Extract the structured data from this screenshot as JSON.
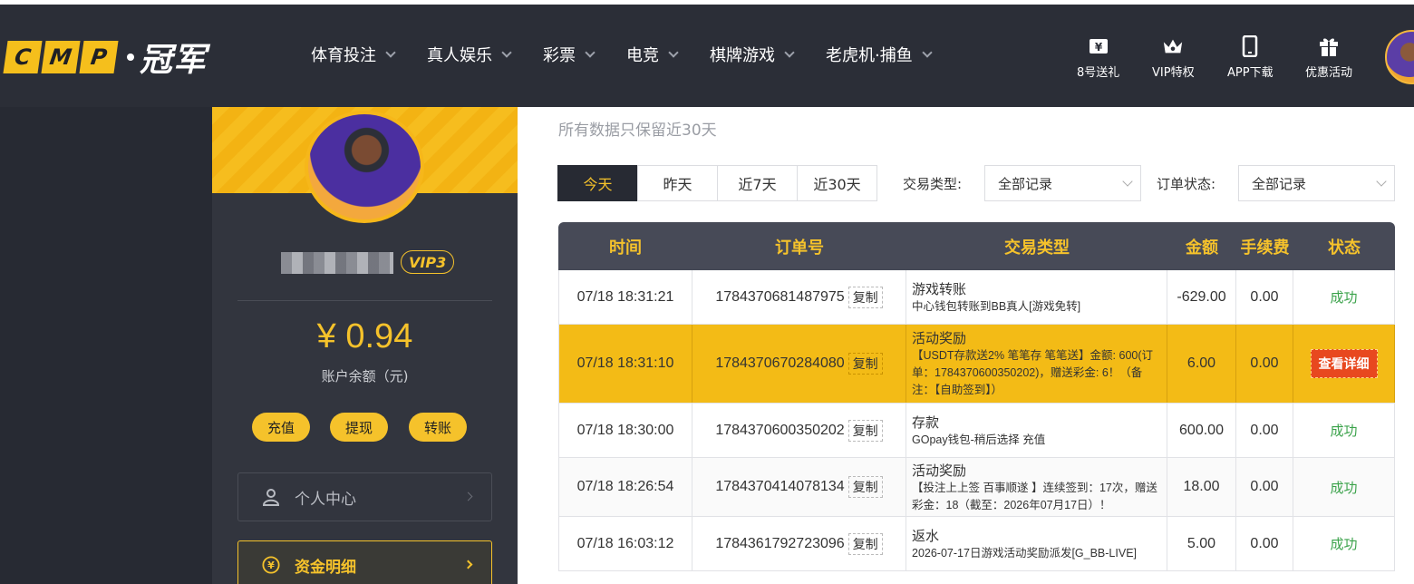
{
  "header": {
    "logo_letters": [
      "C",
      "M",
      "P"
    ],
    "logo_cn": "冠军",
    "nav": [
      {
        "label": "体育投注"
      },
      {
        "label": "真人娱乐"
      },
      {
        "label": "彩票"
      },
      {
        "label": "电竞"
      },
      {
        "label": "棋牌游戏"
      },
      {
        "label": "老虎机·捕鱼"
      }
    ],
    "quick_links": [
      {
        "label": "8号送礼",
        "icon": "gift-ticket-icon"
      },
      {
        "label": "VIP特权",
        "icon": "crown-icon"
      },
      {
        "label": "APP下载",
        "icon": "phone-icon"
      },
      {
        "label": "优惠活动",
        "icon": "gift-box-icon"
      }
    ]
  },
  "sidebar": {
    "vip_label": "VIP3",
    "balance": "¥ 0.94",
    "balance_label": "账户余额（元)",
    "buttons": {
      "deposit": "充值",
      "withdraw": "提现",
      "transfer": "转账"
    },
    "menu": [
      {
        "label": "个人中心",
        "icon": "user-icon",
        "active": false
      },
      {
        "label": "资金明细",
        "icon": "yuan-coin-icon",
        "active": true
      }
    ]
  },
  "main": {
    "notice": "所有数据只保留近30天",
    "tabs": [
      "今天",
      "昨天",
      "近7天",
      "近30天"
    ],
    "active_tab": "今天",
    "filters": {
      "type_label": "交易类型:",
      "type_value": "全部记录",
      "status_label": "订单状态:",
      "status_value": "全部记录"
    },
    "table": {
      "headers": [
        "时间",
        "订单号",
        "交易类型",
        "金额",
        "手续费",
        "状态"
      ],
      "copy_label": "复制",
      "rows": [
        {
          "time": "07/18 18:31:21",
          "order": "1784370681487975",
          "type_title": "游戏转账",
          "type_desc": "中心钱包转账到BB真人[游戏免转]",
          "amount": "-629.00",
          "fee": "0.00",
          "status": "成功",
          "highlight": false
        },
        {
          "time": "07/18 18:31:10",
          "order": "1784370670284080",
          "type_title": "活动奖励",
          "type_desc": "【USDT存款送2% 笔笔存 笔笔送】金额: 600(订单：1784370600350202)，赠送彩金: 6！（备注：【自助签到】）",
          "amount": "6.00",
          "fee": "0.00",
          "status": "查看详细",
          "highlight": true
        },
        {
          "time": "07/18 18:30:00",
          "order": "1784370600350202",
          "type_title": "存款",
          "type_desc": "GOpay钱包-稍后选择 充值",
          "amount": "600.00",
          "fee": "0.00",
          "status": "成功",
          "highlight": false
        },
        {
          "time": "07/18 18:26:54",
          "order": "1784370414078134",
          "type_title": "活动奖励",
          "type_desc": "【投注上上签 百事顺遂 】连续签到：17次，赠送彩金：18（截至：2026年07月17日）！",
          "amount": "18.00",
          "fee": "0.00",
          "status": "成功",
          "highlight": false
        },
        {
          "time": "07/18 16:03:12",
          "order": "1784361792723096",
          "type_title": "返水",
          "type_desc": "2026-07-17日游戏活动奖励派发[G_BB-LIVE]",
          "amount": "5.00",
          "fee": "0.00",
          "status": "成功",
          "highlight": false
        }
      ]
    }
  },
  "colors": {
    "accent": "#f5c22b",
    "dark_bg": "#2b2e37",
    "success": "#3aa24a",
    "detail_button": "#e8481f"
  }
}
